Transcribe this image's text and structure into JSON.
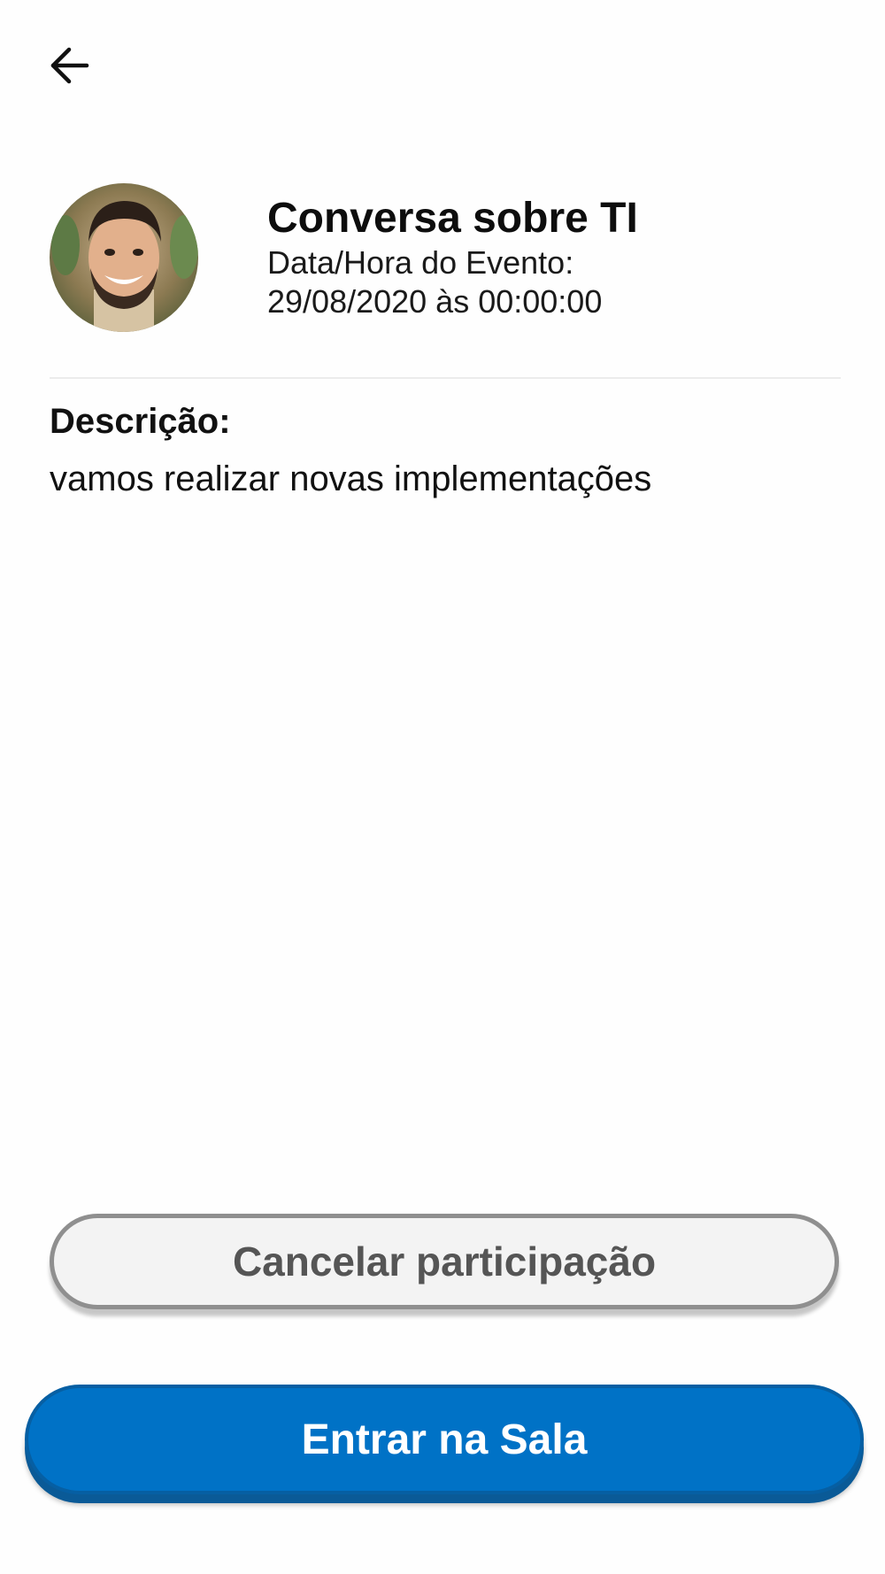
{
  "header": {
    "back_icon": "arrow-left-icon"
  },
  "event": {
    "avatar_icon": "person-photo",
    "title": "Conversa sobre TI",
    "date_label": "Data/Hora do Evento:",
    "date_value": "29/08/2020 às 00:00:00"
  },
  "description": {
    "heading": "Descrição:",
    "text": "vamos realizar novas implementações"
  },
  "actions": {
    "cancel_label": "Cancelar participação",
    "enter_label": "Entrar na Sala"
  },
  "colors": {
    "primary": "#0072c6",
    "cancel_background": "#f3f3f3",
    "cancel_text": "#555555"
  }
}
